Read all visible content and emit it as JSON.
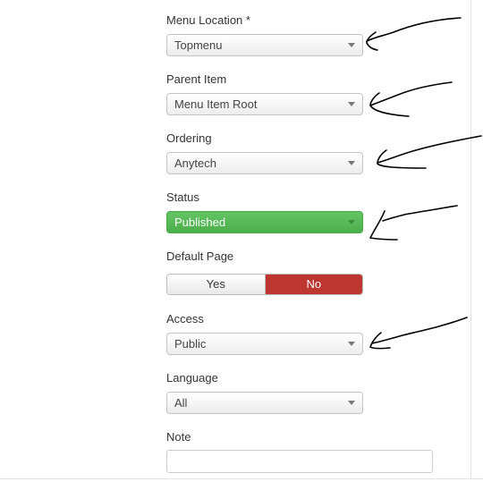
{
  "form": {
    "menu_location": {
      "label": "Menu Location *",
      "value": "Topmenu"
    },
    "parent_item": {
      "label": "Parent Item",
      "value": "Menu Item Root"
    },
    "ordering": {
      "label": "Ordering",
      "value": "Anytech"
    },
    "status": {
      "label": "Status",
      "value": "Published",
      "color": "#5bb75b"
    },
    "default_page": {
      "label": "Default Page",
      "yes": "Yes",
      "no": "No",
      "selected": "No",
      "active_color": "#bd362f"
    },
    "access": {
      "label": "Access",
      "value": "Public"
    },
    "language": {
      "label": "Language",
      "value": "All"
    },
    "note": {
      "label": "Note",
      "value": ""
    }
  },
  "annotations": {
    "arrow_count": 5,
    "stroke_color": "#000000",
    "icon": "hand-drawn-arrow-icon"
  }
}
